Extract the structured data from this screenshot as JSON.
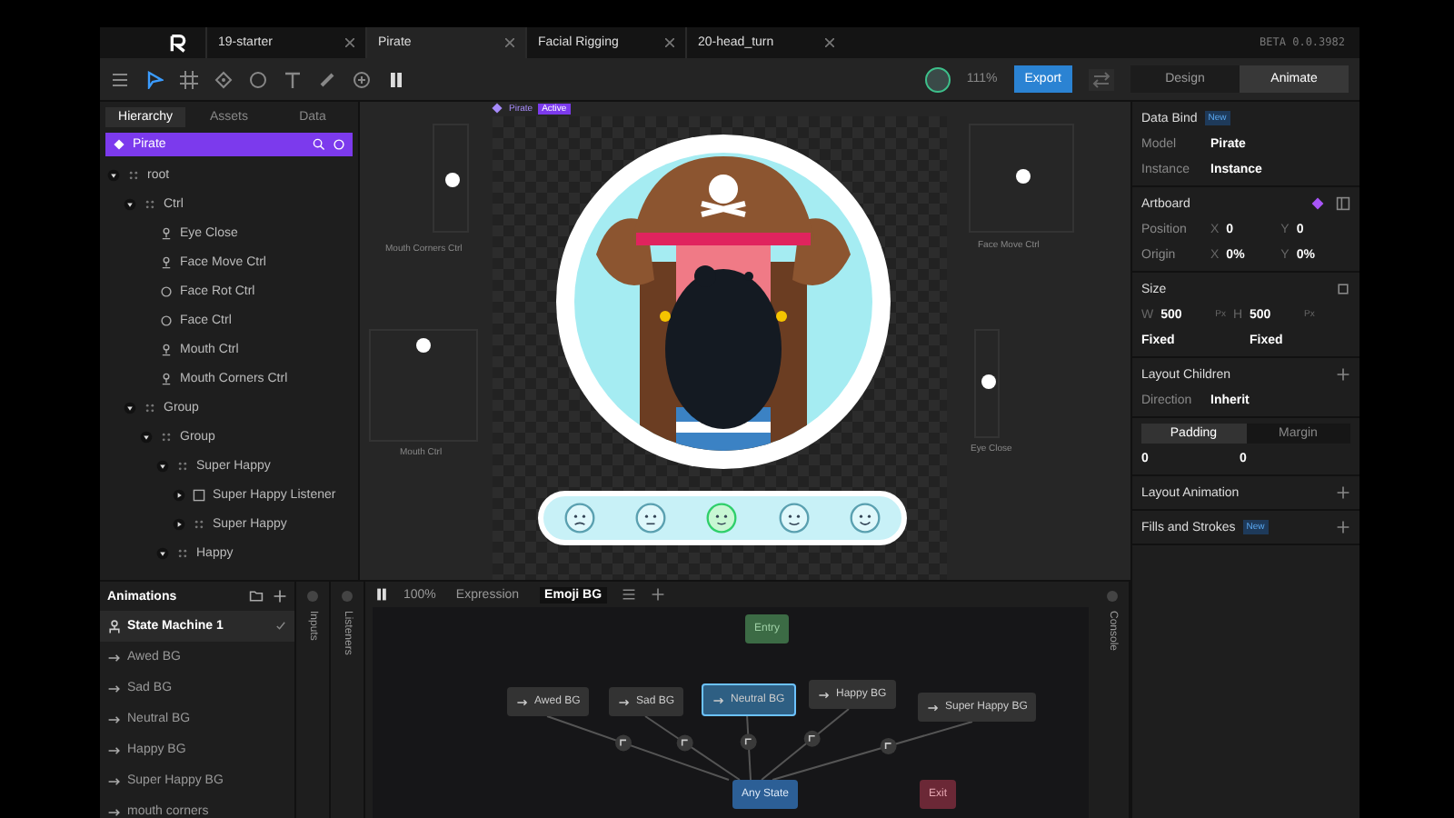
{
  "tabs": [
    {
      "label": "19-starter",
      "selected": false
    },
    {
      "label": "Pirate",
      "selected": true
    },
    {
      "label": "Facial Rigging",
      "selected": false
    },
    {
      "label": "20-head_turn",
      "selected": false
    }
  ],
  "version": "BETA 0.0.3982",
  "toolbar": {
    "zoom": "111%",
    "export": "Export",
    "modes": [
      {
        "label": "Design",
        "selected": false
      },
      {
        "label": "Animate",
        "selected": true
      }
    ]
  },
  "hierarchy": {
    "tabs": [
      {
        "label": "Hierarchy",
        "selected": true
      },
      {
        "label": "Assets",
        "selected": false
      },
      {
        "label": "Data",
        "selected": false
      }
    ],
    "artboard": "Pirate",
    "tree": [
      {
        "label": "root",
        "kind": "group",
        "expanded": true,
        "children": [
          {
            "label": "Ctrl",
            "kind": "group",
            "expanded": true,
            "children": [
              {
                "label": "Eye Close",
                "kind": "bone"
              },
              {
                "label": "Face Move Ctrl",
                "kind": "bone"
              },
              {
                "label": "Face Rot Ctrl",
                "kind": "target"
              },
              {
                "label": "Face Ctrl",
                "kind": "target"
              },
              {
                "label": "Mouth Ctrl",
                "kind": "bone"
              },
              {
                "label": "Mouth Corners Ctrl",
                "kind": "bone"
              }
            ]
          },
          {
            "label": "Group",
            "kind": "group",
            "expanded": true,
            "children": [
              {
                "label": "Group",
                "kind": "group",
                "expanded": true,
                "children": [
                  {
                    "label": "Super Happy",
                    "kind": "group",
                    "expanded": true,
                    "children": [
                      {
                        "label": "Super Happy Listener",
                        "kind": "listener",
                        "expanded": false
                      },
                      {
                        "label": "Super Happy",
                        "kind": "group",
                        "expanded": false
                      }
                    ]
                  },
                  {
                    "label": "Happy",
                    "kind": "group",
                    "expanded": true
                  }
                ]
              }
            ]
          }
        ]
      }
    ]
  },
  "canvas": {
    "artboard": "Pirate",
    "badge": "Active",
    "controls": [
      {
        "label": "Mouth Corners Ctrl"
      },
      {
        "label": "Face Move Ctrl"
      },
      {
        "label": "Mouth Ctrl"
      },
      {
        "label": "Eye Close"
      }
    ],
    "emojis": [
      {
        "selected": false
      },
      {
        "selected": false
      },
      {
        "selected": true
      },
      {
        "selected": false
      },
      {
        "selected": false
      }
    ]
  },
  "inspector": {
    "data_bind": {
      "title": "Data Bind",
      "badge": "New",
      "rows": [
        {
          "label": "Model",
          "value": "Pirate"
        },
        {
          "label": "Instance",
          "value": "Instance"
        }
      ]
    },
    "artboard": {
      "title": "Artboard",
      "rows": [
        {
          "label": "Position",
          "fields": [
            {
              "prefix": "X",
              "value": "0"
            },
            {
              "prefix": "Y",
              "value": "0"
            }
          ]
        },
        {
          "label": "Origin",
          "fields": [
            {
              "prefix": "X",
              "value": "0%"
            },
            {
              "prefix": "Y",
              "value": "0%"
            }
          ]
        }
      ]
    },
    "size": {
      "title": "Size",
      "fields": [
        {
          "prefix": "W",
          "value": "500",
          "unit": "Px"
        },
        {
          "prefix": "H",
          "value": "500",
          "unit": "Px"
        }
      ],
      "modes": [
        "Fixed",
        "Fixed"
      ]
    },
    "layout_children": {
      "title": "Layout Children",
      "rows": [
        {
          "label": "Direction",
          "value": "Inherit"
        }
      ]
    },
    "spacing": {
      "tabs": [
        {
          "label": "Padding",
          "selected": true
        },
        {
          "label": "Margin",
          "selected": false
        }
      ],
      "values": [
        "0",
        "0"
      ]
    },
    "sections": [
      {
        "title": "Layout Animation"
      },
      {
        "title": "Fills and Strokes",
        "badge": "New"
      }
    ]
  },
  "animations": {
    "title": "Animations",
    "items": [
      {
        "label": "State Machine 1",
        "kind": "state_machine",
        "selected": true
      },
      {
        "label": "Awed BG",
        "kind": "animation",
        "selected": false
      },
      {
        "label": "Sad BG",
        "kind": "animation",
        "selected": false
      },
      {
        "label": "Neutral BG",
        "kind": "animation",
        "selected": false
      },
      {
        "label": "Happy BG",
        "kind": "animation",
        "selected": false
      },
      {
        "label": "Super Happy BG",
        "kind": "animation",
        "selected": false
      },
      {
        "label": "mouth corners",
        "kind": "animation",
        "selected": false
      }
    ]
  },
  "side_tabs": {
    "inputs": "Inputs",
    "listeners": "Listeners",
    "console": "Console"
  },
  "graph": {
    "zoom": "100%",
    "tabs": [
      {
        "label": "Expression",
        "selected": false
      },
      {
        "label": "Emoji BG",
        "selected": true
      }
    ],
    "nodes": [
      {
        "label": "Entry",
        "kind": "entry",
        "selected": false
      },
      {
        "label": "Awed BG",
        "kind": "state",
        "selected": false
      },
      {
        "label": "Sad BG",
        "kind": "state",
        "selected": false
      },
      {
        "label": "Neutral BG",
        "kind": "state",
        "selected": true
      },
      {
        "label": "Happy BG",
        "kind": "state",
        "selected": false
      },
      {
        "label": "Super Happy BG",
        "kind": "state",
        "selected": false
      },
      {
        "label": "Any State",
        "kind": "any",
        "selected": false
      },
      {
        "label": "Exit",
        "kind": "exit",
        "selected": false
      }
    ]
  }
}
